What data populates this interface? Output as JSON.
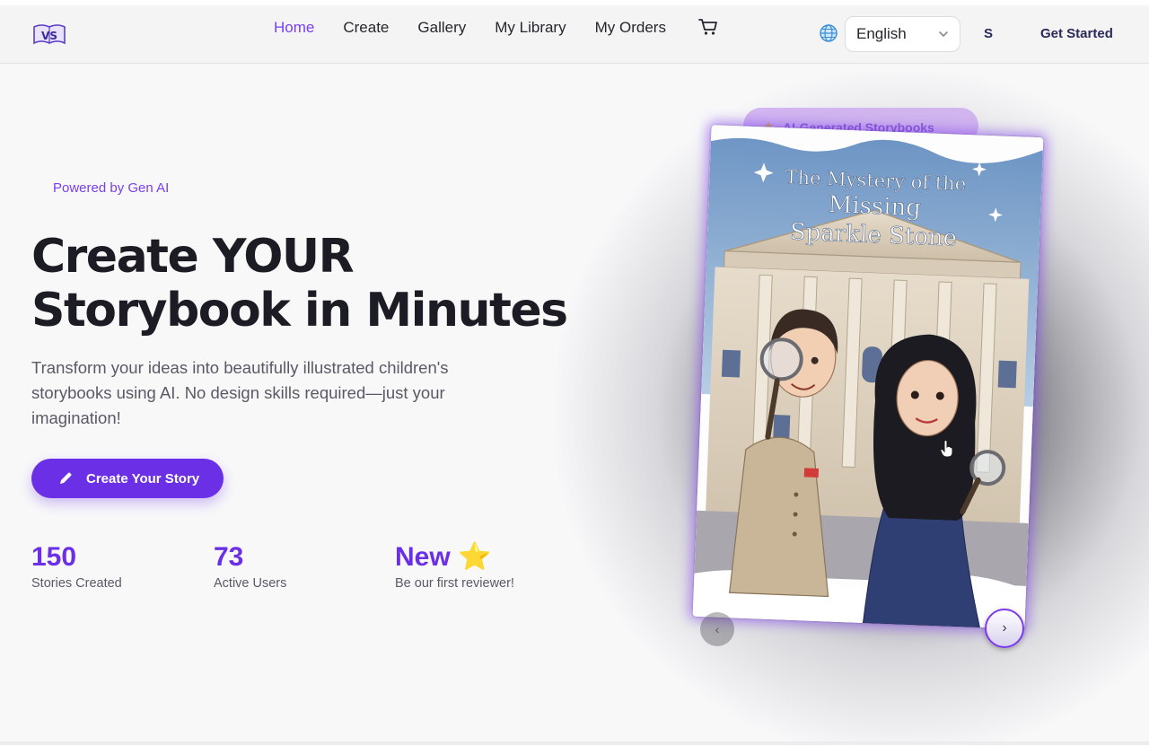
{
  "nav": {
    "logo_text": "VS",
    "links": [
      {
        "label": "Home",
        "active": true
      },
      {
        "label": "Create",
        "active": false
      },
      {
        "label": "Gallery",
        "active": false
      },
      {
        "label": "My Library",
        "active": false
      },
      {
        "label": "My Orders",
        "active": false
      }
    ],
    "language_selected": "English",
    "user_initial": "S",
    "get_started_label": "Get Started"
  },
  "hero": {
    "powered_label": "Powered by Gen AI",
    "title_line1": "Create YOUR",
    "title_line2": "Storybook in Minutes",
    "description": "Transform your ideas into beautifully illustrated children's storybooks using AI. No design skills required—just your imagination!",
    "cta_label": "Create Your Story",
    "stats": [
      {
        "value": "150",
        "label": "Stories Created"
      },
      {
        "value": "73",
        "label": "Active Users"
      },
      {
        "value": "New ⭐",
        "label": "Be our first reviewer!"
      }
    ]
  },
  "showcase": {
    "badge_label": "AI-Generated Storybooks",
    "book_title_line1": "The Mystery of the",
    "book_title_line2": "Missing",
    "book_title_line3": "Sparkle Stone",
    "prev_label": "‹",
    "next_label": "›"
  },
  "colors": {
    "accent": "#6b2fe6",
    "active_nav": "#7a3ff0",
    "heading": "#1c1c24"
  }
}
